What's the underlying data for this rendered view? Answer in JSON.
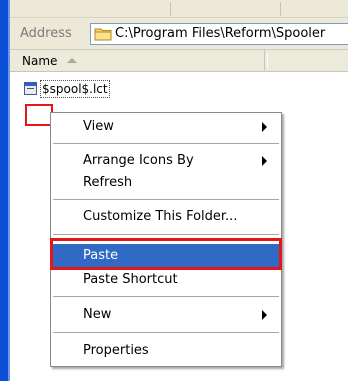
{
  "address_bar": {
    "label": "Address",
    "path": "C:\\Program Files\\Reform\\Spooler"
  },
  "file_list": {
    "column_name": "Name",
    "files": [
      {
        "name": "$spool$.lct"
      }
    ]
  },
  "context_menu": {
    "items": {
      "view": "View",
      "arrange_icons_by": "Arrange Icons By",
      "refresh": "Refresh",
      "customize_folder": "Customize This Folder...",
      "paste": "Paste",
      "paste_shortcut": "Paste Shortcut",
      "new": "New",
      "properties": "Properties"
    },
    "highlighted_item": "paste"
  },
  "colors": {
    "menu_highlight": "#316ac5",
    "annotation_red": "#e01818",
    "taskpane_blue": "#0b4fd8"
  }
}
